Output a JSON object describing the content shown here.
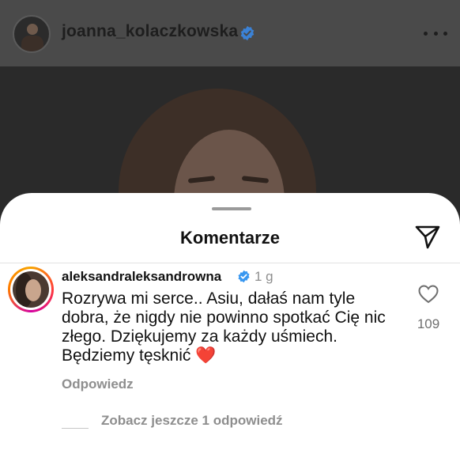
{
  "post": {
    "username": "joanna_kolaczkowska",
    "verified_icon": "verified-badge-icon",
    "more_icon": "more-options-icon"
  },
  "sheet": {
    "title": "Komentarze",
    "share_icon": "send-icon"
  },
  "comment": {
    "author": "aleksandraleksandrowna",
    "time": "1 g",
    "text": "Rozrywa mi serce.. Asiu, dałaś nam tyle dobra, że nigdy nie powinno spotkać Cię nic złego. Dziękujemy za każdy uśmiech. Będziemy tęsknić",
    "emoji": "❤️",
    "like_count": "109",
    "reply_label": "Odpowiedz",
    "view_replies_label": "Zobacz jeszcze 1 odpowiedź"
  },
  "colors": {
    "verified": "#3897f0",
    "secondary_text": "#8e8e8e",
    "heart_emoji": "#d22b2b"
  }
}
